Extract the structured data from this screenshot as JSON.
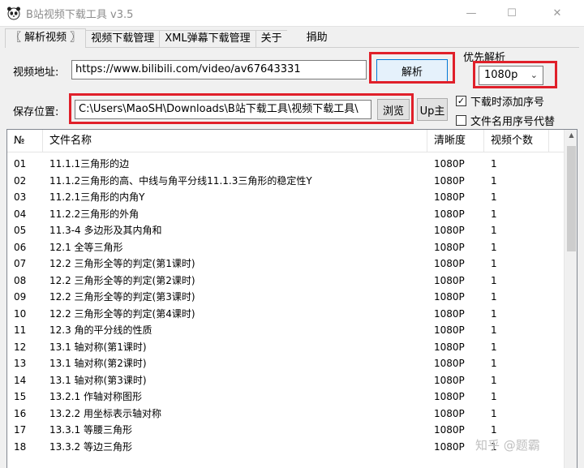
{
  "window": {
    "title": "B站视频下载工具 v3.5",
    "minimize_glyph": "—",
    "maximize_glyph": "☐",
    "close_glyph": "✕",
    "icon": "panda-app-icon"
  },
  "tabs": [
    {
      "label": "〖 解析视频 〗",
      "active": true
    },
    {
      "label": "视频下载管理",
      "active": false
    },
    {
      "label": "XML弹幕下载管理",
      "active": false
    },
    {
      "label": "关于",
      "active": false
    },
    {
      "label": "捐助",
      "active": false
    }
  ],
  "form": {
    "url_label": "视频地址:",
    "url_value": "https://www.bilibili.com/video/av67643331",
    "parse_button": "解析",
    "save_label": "保存位置:",
    "save_value": "C:\\Users\\MaoSH\\Downloads\\B站下载工具\\视频下载工具\\",
    "browse_button": "浏览",
    "up_button": "Up主",
    "priority_title": "优先解析",
    "priority_value": "1080p",
    "priority_arrow": "⌄",
    "chk_add_seq": {
      "label": "下载时添加序号",
      "checked": true
    },
    "chk_seq_replace": {
      "label": "文件名用序号代替",
      "checked": false
    }
  },
  "table": {
    "columns": [
      "№",
      "文件名称",
      "清晰度",
      "视频个数"
    ],
    "rows": [
      {
        "no": "01",
        "name": "11.1.1三角形的边",
        "res": "1080P",
        "count": "1"
      },
      {
        "no": "02",
        "name": "11.1.2三角形的高、中线与角平分线11.1.3三角形的稳定性Y",
        "res": "1080P",
        "count": "1"
      },
      {
        "no": "03",
        "name": "11.2.1三角形的内角Y",
        "res": "1080P",
        "count": "1"
      },
      {
        "no": "04",
        "name": "11.2.2三角形的外角",
        "res": "1080P",
        "count": "1"
      },
      {
        "no": "05",
        "name": "11.3-4 多边形及其内角和",
        "res": "1080P",
        "count": "1"
      },
      {
        "no": "06",
        "name": "12.1 全等三角形",
        "res": "1080P",
        "count": "1"
      },
      {
        "no": "07",
        "name": "12.2 三角形全等的判定(第1课时)",
        "res": "1080P",
        "count": "1"
      },
      {
        "no": "08",
        "name": "12.2 三角形全等的判定(第2课时)",
        "res": "1080P",
        "count": "1"
      },
      {
        "no": "09",
        "name": "12.2 三角形全等的判定(第3课时)",
        "res": "1080P",
        "count": "1"
      },
      {
        "no": "10",
        "name": "12.2 三角形全等的判定(第4课时)",
        "res": "1080P",
        "count": "1"
      },
      {
        "no": "11",
        "name": "12.3 角的平分线的性质",
        "res": "1080P",
        "count": "1"
      },
      {
        "no": "12",
        "name": "13.1 轴对称(第1课时)",
        "res": "1080P",
        "count": "1"
      },
      {
        "no": "13",
        "name": "13.1 轴对称(第2课时)",
        "res": "1080P",
        "count": "1"
      },
      {
        "no": "14",
        "name": "13.1 轴对称(第3课时)",
        "res": "1080P",
        "count": "1"
      },
      {
        "no": "15",
        "name": "13.2.1 作轴对称图形",
        "res": "1080P",
        "count": "1"
      },
      {
        "no": "16",
        "name": "13.2.2 用坐标表示轴对称",
        "res": "1080P",
        "count": "1"
      },
      {
        "no": "17",
        "name": "13.3.1 等腰三角形",
        "res": "1080P",
        "count": "1"
      },
      {
        "no": "18",
        "name": "13.3.2 等边三角形",
        "res": "1080P",
        "count": "1"
      }
    ],
    "scroll_up_glyph": "▲"
  },
  "watermark": "知乎 @题霸",
  "colors": {
    "highlight_box": "#e0202a",
    "default_button_border": "#0078d7"
  }
}
